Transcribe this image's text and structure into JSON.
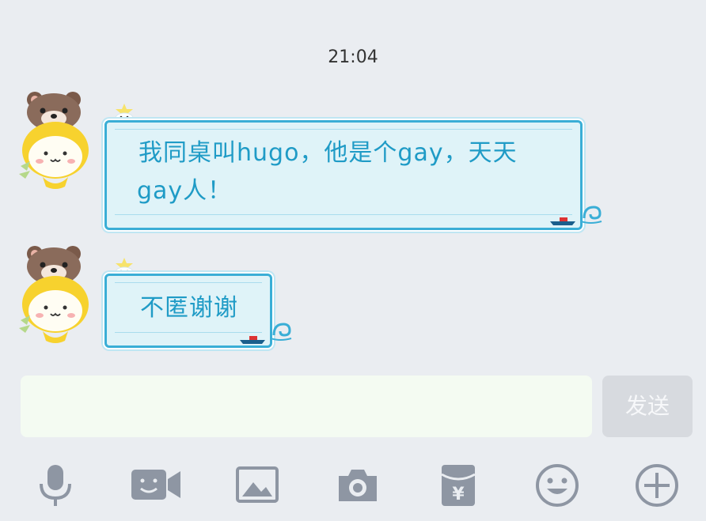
{
  "chat": {
    "timestamp": "21:04",
    "messages": [
      {
        "sender_avatar": "cartoon-bear-avatar",
        "text_line1": "我同桌叫hugo，他是个gay，天天",
        "text_line2": "gay人！"
      },
      {
        "sender_avatar": "cartoon-bear-avatar",
        "text_line1": "不匿谢谢"
      }
    ]
  },
  "composer": {
    "input_value": "",
    "input_placeholder": "",
    "send_label": "发送"
  },
  "toolbar": {
    "icons": [
      "microphone-icon",
      "video-call-icon",
      "image-icon",
      "camera-icon",
      "red-packet-icon",
      "emoji-icon",
      "plus-icon"
    ]
  },
  "colors": {
    "background": "#eaedf1",
    "bubble_fill": "#dff3f8",
    "bubble_border": "#3aaed6",
    "bubble_text": "#1f9bc6",
    "icon_gray": "#8e96a3",
    "send_disabled": "#d7dadf"
  }
}
